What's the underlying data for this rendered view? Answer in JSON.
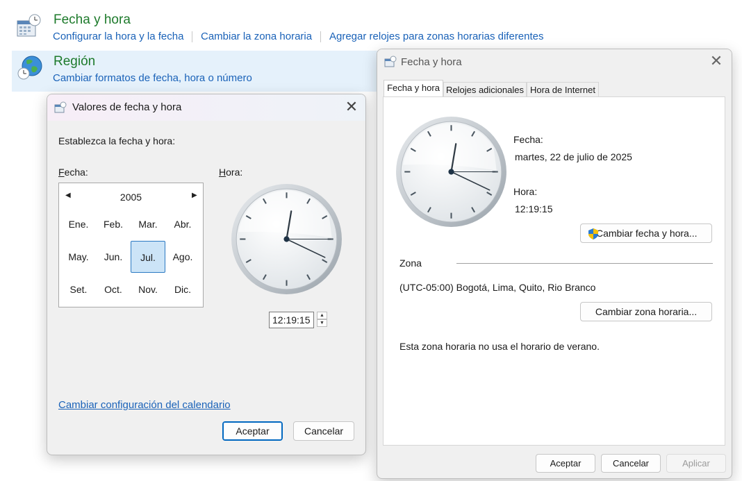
{
  "control_panel": {
    "datetime": {
      "title": "Fecha y hora",
      "links": [
        "Configurar la hora y la fecha",
        "Cambiar la zona horaria",
        "Agregar relojes para zonas horarias diferentes"
      ]
    },
    "region": {
      "title": "Región",
      "link": "Cambiar formatos de fecha, hora o número"
    }
  },
  "dlg_left": {
    "title": "Valores de fecha y hora",
    "instruction": "Establezca la fecha y hora:",
    "date_label_rest": "echa:",
    "date_label_key": "F",
    "time_label_rest": "ora:",
    "time_label_key": "H",
    "calendar": {
      "year": "2005",
      "months": [
        "Ene.",
        "Feb.",
        "Mar.",
        "Abr.",
        "May.",
        "Jun.",
        "Jul.",
        "Ago.",
        "Set.",
        "Oct.",
        "Nov.",
        "Dic."
      ],
      "selected_month": "Jul."
    },
    "time_value": "12:19:15",
    "calendar_link": "Cambiar configuración del calendario",
    "ok": "Aceptar",
    "cancel": "Cancelar"
  },
  "dlg_right": {
    "title": "Fecha y hora",
    "tabs": [
      "Fecha y hora",
      "Relojes adicionales",
      "Hora de Internet"
    ],
    "active_tab": "Fecha y hora",
    "date_label": "Fecha:",
    "date_value": "martes, 22 de julio de 2025",
    "time_label": "Hora:",
    "time_value": "12:19:15",
    "change_datetime_btn": "Cambiar fecha y hora...",
    "zone_label": "Zona",
    "zone_value": "(UTC-05:00) Bogotá, Lima, Quito, Rio Branco",
    "change_zone_btn": "Cambiar zona horaria...",
    "dst_note": "Esta zona horaria no usa el horario de verano.",
    "ok": "Aceptar",
    "cancel": "Cancelar",
    "apply": "Aplicar"
  },
  "clock": {
    "hours": 12,
    "minutes": 19,
    "seconds": 15
  },
  "colors": {
    "link": "#1a62b8",
    "title_green": "#1d7a2b",
    "selection": "#cce4f7",
    "accent": "#0067c0"
  }
}
